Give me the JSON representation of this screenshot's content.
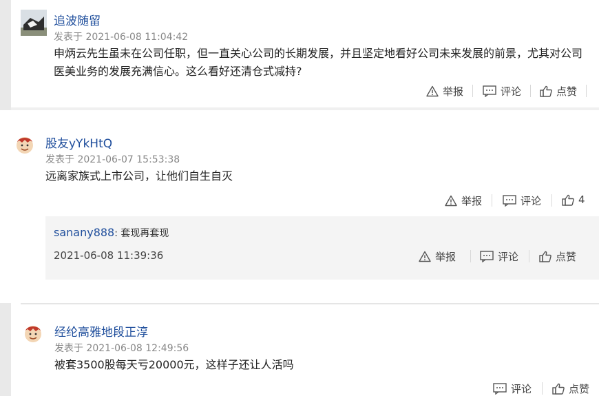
{
  "comments": [
    {
      "author": "追波随留",
      "time": "发表于 2021-06-08 11:04:42",
      "text": "申炳云先生虽未在公司任职，但一直关心公司的长期发展，并且坚定地看好公司未来发展的前景，尤其对公司医美业务的发展充满信心。这么看好还清仓式减持?",
      "actions": {
        "report": "举报",
        "comment": "评论",
        "like": "点赞"
      }
    },
    {
      "author": "股友yYkHtQ",
      "time": "发表于 2021-06-07 15:53:38",
      "text": "远离家族式上市公司，让他们自生自灭",
      "actions": {
        "report": "举报",
        "comment": "评论",
        "like": "4"
      },
      "reply": {
        "author": "sanany888",
        "text": ": 套现再套现",
        "time": "2021-06-08 11:39:36",
        "actions": {
          "report": "举报",
          "comment": "评论",
          "like": "点赞"
        }
      }
    },
    {
      "author": "经纶高雅地段正淳",
      "time": "发表于 2021-06-08 12:49:56",
      "text": "被套3500股每天亏20000元，这样子还让人活吗",
      "actions": {
        "comment": "评论",
        "like": "点赞"
      }
    }
  ],
  "colors": {
    "link": "#1f4e9c",
    "reply_bg": "#f4f4f4",
    "divider": "#e5e5e5",
    "left_bar": "#e9e9e9"
  }
}
